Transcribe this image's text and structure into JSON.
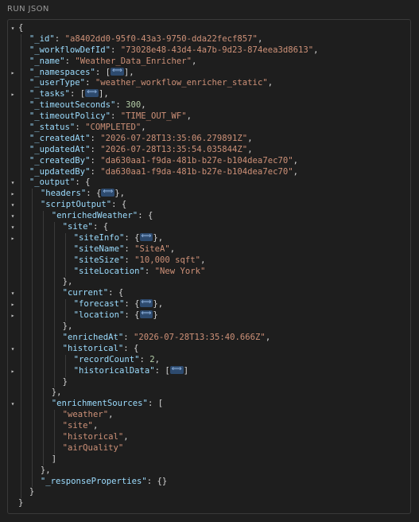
{
  "header": {
    "title": "RUN JSON"
  },
  "lines": [
    {
      "indent": 0,
      "arrow": "down",
      "segs": [
        {
          "t": "p",
          "v": "{"
        }
      ]
    },
    {
      "indent": 1,
      "arrow": "",
      "segs": [
        {
          "t": "k",
          "v": "\"_id\""
        },
        {
          "t": "p",
          "v": ": "
        },
        {
          "t": "s",
          "v": "\"a8402dd0-95f0-43a3-9750-dda22fecf857\""
        },
        {
          "t": "p",
          "v": ","
        }
      ]
    },
    {
      "indent": 1,
      "arrow": "",
      "segs": [
        {
          "t": "k",
          "v": "\"_workflowDefId\""
        },
        {
          "t": "p",
          "v": ": "
        },
        {
          "t": "s",
          "v": "\"73028e48-43d4-4a7b-9d23-874eea3d8613\""
        },
        {
          "t": "p",
          "v": ","
        }
      ]
    },
    {
      "indent": 1,
      "arrow": "",
      "segs": [
        {
          "t": "k",
          "v": "\"_name\""
        },
        {
          "t": "p",
          "v": ": "
        },
        {
          "t": "s",
          "v": "\"Weather_Data_Enricher\""
        },
        {
          "t": "p",
          "v": ","
        }
      ]
    },
    {
      "indent": 1,
      "arrow": "right",
      "segs": [
        {
          "t": "k",
          "v": "\"_namespaces\""
        },
        {
          "t": "p",
          "v": ": ["
        },
        {
          "t": "f",
          "v": "⟺"
        },
        {
          "t": "p",
          "v": "],"
        }
      ]
    },
    {
      "indent": 1,
      "arrow": "",
      "segs": [
        {
          "t": "k",
          "v": "\"_userType\""
        },
        {
          "t": "p",
          "v": ": "
        },
        {
          "t": "s",
          "v": "\"weather_workflow_enricher_static\""
        },
        {
          "t": "p",
          "v": ","
        }
      ]
    },
    {
      "indent": 1,
      "arrow": "right",
      "segs": [
        {
          "t": "k",
          "v": "\"_tasks\""
        },
        {
          "t": "p",
          "v": ": ["
        },
        {
          "t": "f",
          "v": "⟺"
        },
        {
          "t": "p",
          "v": "],"
        }
      ]
    },
    {
      "indent": 1,
      "arrow": "",
      "segs": [
        {
          "t": "k",
          "v": "\"_timeoutSeconds\""
        },
        {
          "t": "p",
          "v": ": "
        },
        {
          "t": "n",
          "v": "300"
        },
        {
          "t": "p",
          "v": ","
        }
      ]
    },
    {
      "indent": 1,
      "arrow": "",
      "segs": [
        {
          "t": "k",
          "v": "\"_timeoutPolicy\""
        },
        {
          "t": "p",
          "v": ": "
        },
        {
          "t": "s",
          "v": "\"TIME_OUT_WF\""
        },
        {
          "t": "p",
          "v": ","
        }
      ]
    },
    {
      "indent": 1,
      "arrow": "",
      "segs": [
        {
          "t": "k",
          "v": "\"_status\""
        },
        {
          "t": "p",
          "v": ": "
        },
        {
          "t": "s",
          "v": "\"COMPLETED\""
        },
        {
          "t": "p",
          "v": ","
        }
      ]
    },
    {
      "indent": 1,
      "arrow": "",
      "segs": [
        {
          "t": "k",
          "v": "\"_createdAt\""
        },
        {
          "t": "p",
          "v": ": "
        },
        {
          "t": "s",
          "v": "\"2026-07-28T13:35:06.279891Z\""
        },
        {
          "t": "p",
          "v": ","
        }
      ]
    },
    {
      "indent": 1,
      "arrow": "",
      "segs": [
        {
          "t": "k",
          "v": "\"_updatedAt\""
        },
        {
          "t": "p",
          "v": ": "
        },
        {
          "t": "s",
          "v": "\"2026-07-28T13:35:54.035844Z\""
        },
        {
          "t": "p",
          "v": ","
        }
      ]
    },
    {
      "indent": 1,
      "arrow": "",
      "segs": [
        {
          "t": "k",
          "v": "\"_createdBy\""
        },
        {
          "t": "p",
          "v": ": "
        },
        {
          "t": "s",
          "v": "\"da630aa1-f9da-481b-b27e-b104dea7ec70\""
        },
        {
          "t": "p",
          "v": ","
        }
      ]
    },
    {
      "indent": 1,
      "arrow": "",
      "segs": [
        {
          "t": "k",
          "v": "\"_updatedBy\""
        },
        {
          "t": "p",
          "v": ": "
        },
        {
          "t": "s",
          "v": "\"da630aa1-f9da-481b-b27e-b104dea7ec70\""
        },
        {
          "t": "p",
          "v": ","
        }
      ]
    },
    {
      "indent": 1,
      "arrow": "down",
      "segs": [
        {
          "t": "k",
          "v": "\"_output\""
        },
        {
          "t": "p",
          "v": ": {"
        }
      ]
    },
    {
      "indent": 2,
      "arrow": "right",
      "segs": [
        {
          "t": "k",
          "v": "\"headers\""
        },
        {
          "t": "p",
          "v": ": {"
        },
        {
          "t": "f",
          "v": "⟺"
        },
        {
          "t": "p",
          "v": "},"
        }
      ]
    },
    {
      "indent": 2,
      "arrow": "down",
      "segs": [
        {
          "t": "k",
          "v": "\"scriptOutput\""
        },
        {
          "t": "p",
          "v": ": {"
        }
      ]
    },
    {
      "indent": 3,
      "arrow": "down",
      "segs": [
        {
          "t": "k",
          "v": "\"enrichedWeather\""
        },
        {
          "t": "p",
          "v": ": {"
        }
      ]
    },
    {
      "indent": 4,
      "arrow": "down",
      "segs": [
        {
          "t": "k",
          "v": "\"site\""
        },
        {
          "t": "p",
          "v": ": {"
        }
      ]
    },
    {
      "indent": 5,
      "arrow": "right",
      "segs": [
        {
          "t": "k",
          "v": "\"siteInfo\""
        },
        {
          "t": "p",
          "v": ": {"
        },
        {
          "t": "f",
          "v": "⟺"
        },
        {
          "t": "p",
          "v": "},"
        }
      ]
    },
    {
      "indent": 5,
      "arrow": "",
      "segs": [
        {
          "t": "k",
          "v": "\"siteName\""
        },
        {
          "t": "p",
          "v": ": "
        },
        {
          "t": "s",
          "v": "\"SiteA\""
        },
        {
          "t": "p",
          "v": ","
        }
      ]
    },
    {
      "indent": 5,
      "arrow": "",
      "segs": [
        {
          "t": "k",
          "v": "\"siteSize\""
        },
        {
          "t": "p",
          "v": ": "
        },
        {
          "t": "s",
          "v": "\"10,000 sqft\""
        },
        {
          "t": "p",
          "v": ","
        }
      ]
    },
    {
      "indent": 5,
      "arrow": "",
      "segs": [
        {
          "t": "k",
          "v": "\"siteLocation\""
        },
        {
          "t": "p",
          "v": ": "
        },
        {
          "t": "s",
          "v": "\"New York\""
        }
      ]
    },
    {
      "indent": 4,
      "arrow": "",
      "segs": [
        {
          "t": "p",
          "v": "},"
        }
      ]
    },
    {
      "indent": 4,
      "arrow": "down",
      "segs": [
        {
          "t": "k",
          "v": "\"current\""
        },
        {
          "t": "p",
          "v": ": {"
        }
      ]
    },
    {
      "indent": 5,
      "arrow": "right",
      "segs": [
        {
          "t": "k",
          "v": "\"forecast\""
        },
        {
          "t": "p",
          "v": ": {"
        },
        {
          "t": "f",
          "v": "⟺"
        },
        {
          "t": "p",
          "v": "},"
        }
      ]
    },
    {
      "indent": 5,
      "arrow": "right",
      "segs": [
        {
          "t": "k",
          "v": "\"location\""
        },
        {
          "t": "p",
          "v": ": {"
        },
        {
          "t": "f",
          "v": "⟺"
        },
        {
          "t": "p",
          "v": "}"
        }
      ]
    },
    {
      "indent": 4,
      "arrow": "",
      "segs": [
        {
          "t": "p",
          "v": "},"
        }
      ]
    },
    {
      "indent": 4,
      "arrow": "",
      "segs": [
        {
          "t": "k",
          "v": "\"enrichedAt\""
        },
        {
          "t": "p",
          "v": ": "
        },
        {
          "t": "s",
          "v": "\"2026-07-28T13:35:40.666Z\""
        },
        {
          "t": "p",
          "v": ","
        }
      ]
    },
    {
      "indent": 4,
      "arrow": "down",
      "segs": [
        {
          "t": "k",
          "v": "\"historical\""
        },
        {
          "t": "p",
          "v": ": {"
        }
      ]
    },
    {
      "indent": 5,
      "arrow": "",
      "segs": [
        {
          "t": "k",
          "v": "\"recordCount\""
        },
        {
          "t": "p",
          "v": ": "
        },
        {
          "t": "n",
          "v": "2"
        },
        {
          "t": "p",
          "v": ","
        }
      ]
    },
    {
      "indent": 5,
      "arrow": "right",
      "segs": [
        {
          "t": "k",
          "v": "\"historicalData\""
        },
        {
          "t": "p",
          "v": ": ["
        },
        {
          "t": "f",
          "v": "⟺"
        },
        {
          "t": "p",
          "v": "]"
        }
      ]
    },
    {
      "indent": 4,
      "arrow": "",
      "segs": [
        {
          "t": "p",
          "v": "}"
        }
      ]
    },
    {
      "indent": 3,
      "arrow": "",
      "segs": [
        {
          "t": "p",
          "v": "},"
        }
      ]
    },
    {
      "indent": 3,
      "arrow": "down",
      "segs": [
        {
          "t": "k",
          "v": "\"enrichmentSources\""
        },
        {
          "t": "p",
          "v": ": ["
        }
      ]
    },
    {
      "indent": 4,
      "arrow": "",
      "segs": [
        {
          "t": "s",
          "v": "\"weather\""
        },
        {
          "t": "p",
          "v": ","
        }
      ]
    },
    {
      "indent": 4,
      "arrow": "",
      "segs": [
        {
          "t": "s",
          "v": "\"site\""
        },
        {
          "t": "p",
          "v": ","
        }
      ]
    },
    {
      "indent": 4,
      "arrow": "",
      "segs": [
        {
          "t": "s",
          "v": "\"historical\""
        },
        {
          "t": "p",
          "v": ","
        }
      ]
    },
    {
      "indent": 4,
      "arrow": "",
      "segs": [
        {
          "t": "s",
          "v": "\"airQuality\""
        }
      ]
    },
    {
      "indent": 3,
      "arrow": "",
      "segs": [
        {
          "t": "p",
          "v": "]"
        }
      ]
    },
    {
      "indent": 2,
      "arrow": "",
      "segs": [
        {
          "t": "p",
          "v": "},"
        }
      ]
    },
    {
      "indent": 2,
      "arrow": "",
      "segs": [
        {
          "t": "k",
          "v": "\"_responseProperties\""
        },
        {
          "t": "p",
          "v": ": {}"
        }
      ]
    },
    {
      "indent": 1,
      "arrow": "",
      "segs": [
        {
          "t": "p",
          "v": "}"
        }
      ]
    },
    {
      "indent": 0,
      "arrow": "",
      "segs": [
        {
          "t": "p",
          "v": "}"
        }
      ]
    }
  ],
  "colors": {
    "key": "#9cdcfe",
    "string": "#ce9178",
    "number": "#b5cea8",
    "punctuation": "#d4d4d4",
    "fold_badge": "#2d4a6e"
  },
  "icons": {
    "expanded": "chevron-down-icon",
    "collapsed": "chevron-right-icon",
    "folded": "ellipsis-fold-icon"
  }
}
